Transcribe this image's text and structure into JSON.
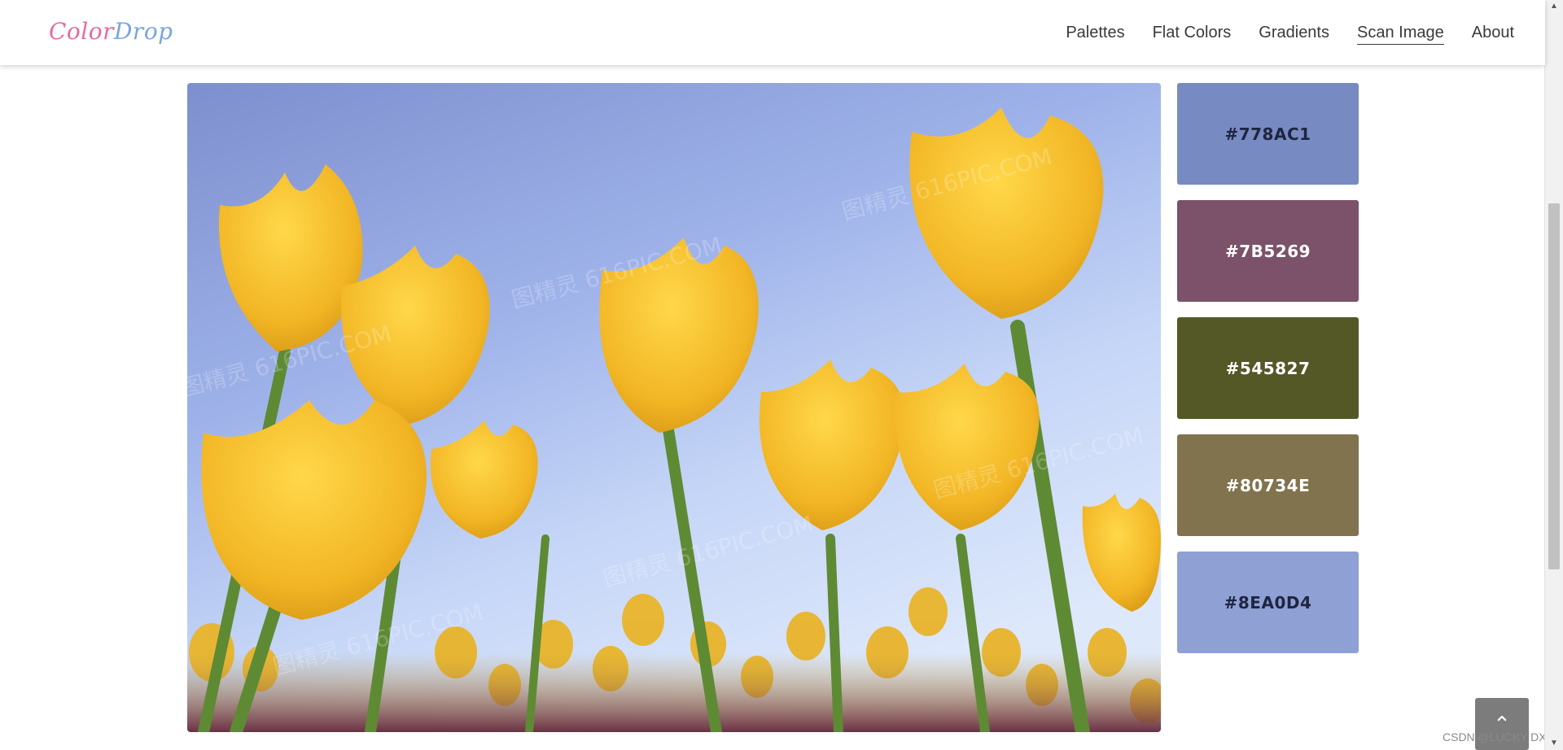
{
  "header": {
    "logo_part1": "Color",
    "logo_part2": "Drop",
    "nav": [
      {
        "label": "Palettes"
      },
      {
        "label": "Flat Colors"
      },
      {
        "label": "Gradients"
      },
      {
        "label": "Scan Image",
        "active": true
      },
      {
        "label": "About"
      }
    ]
  },
  "swatches": [
    {
      "hex": "#778AC1",
      "label": "#778AC1",
      "text_color": "#1f2540"
    },
    {
      "hex": "#7B5269",
      "label": "#7B5269",
      "text_color": "#ffffff"
    },
    {
      "hex": "#545827",
      "label": "#545827",
      "text_color": "#ffffff"
    },
    {
      "hex": "#80734E",
      "label": "#80734E",
      "text_color": "#ffffff"
    },
    {
      "hex": "#8EA0D4",
      "label": "#8EA0D4",
      "text_color": "#1f2540"
    }
  ],
  "photo": {
    "watermark": "图精灵 616PIC.COM"
  },
  "footer": {
    "credit": "CSDN @LUCKY DXP"
  }
}
